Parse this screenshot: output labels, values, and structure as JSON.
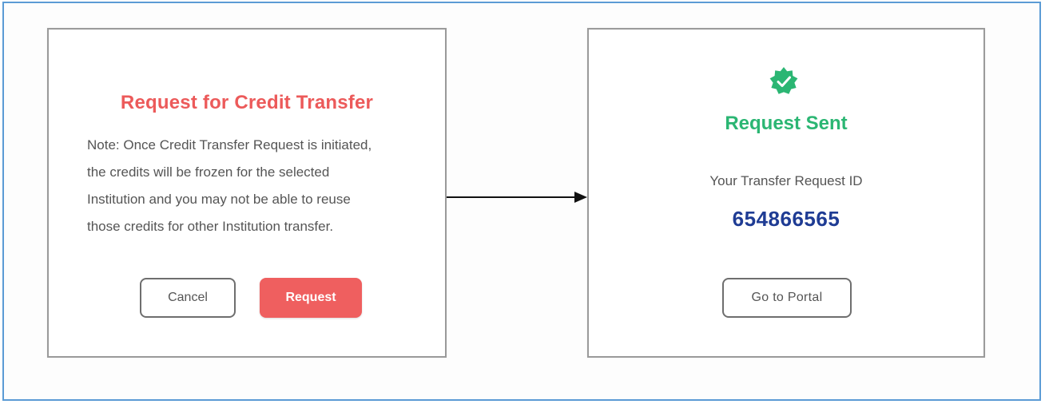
{
  "request_card": {
    "title": "Request for Credit Transfer",
    "note": "Note: Once Credit Transfer Request is initiated,\nthe credits will be frozen for the selected\nInstitution and you may not be able to reuse\nthose credits for other Institution transfer.",
    "cancel_label": "Cancel",
    "request_label": "Request"
  },
  "success_card": {
    "icon": "verified-check-badge-icon",
    "title": "Request Sent",
    "id_label": "Your Transfer Request ID",
    "request_id": "654866565",
    "portal_label": "Go to Portal"
  },
  "flow": {
    "icon": "right-arrow-icon"
  },
  "colors": {
    "frame_border": "#5b9bd5",
    "title_red": "#ec5a5a",
    "request_button": "#ef5f5f",
    "success_green": "#2bb673",
    "id_blue": "#1f3c94"
  }
}
